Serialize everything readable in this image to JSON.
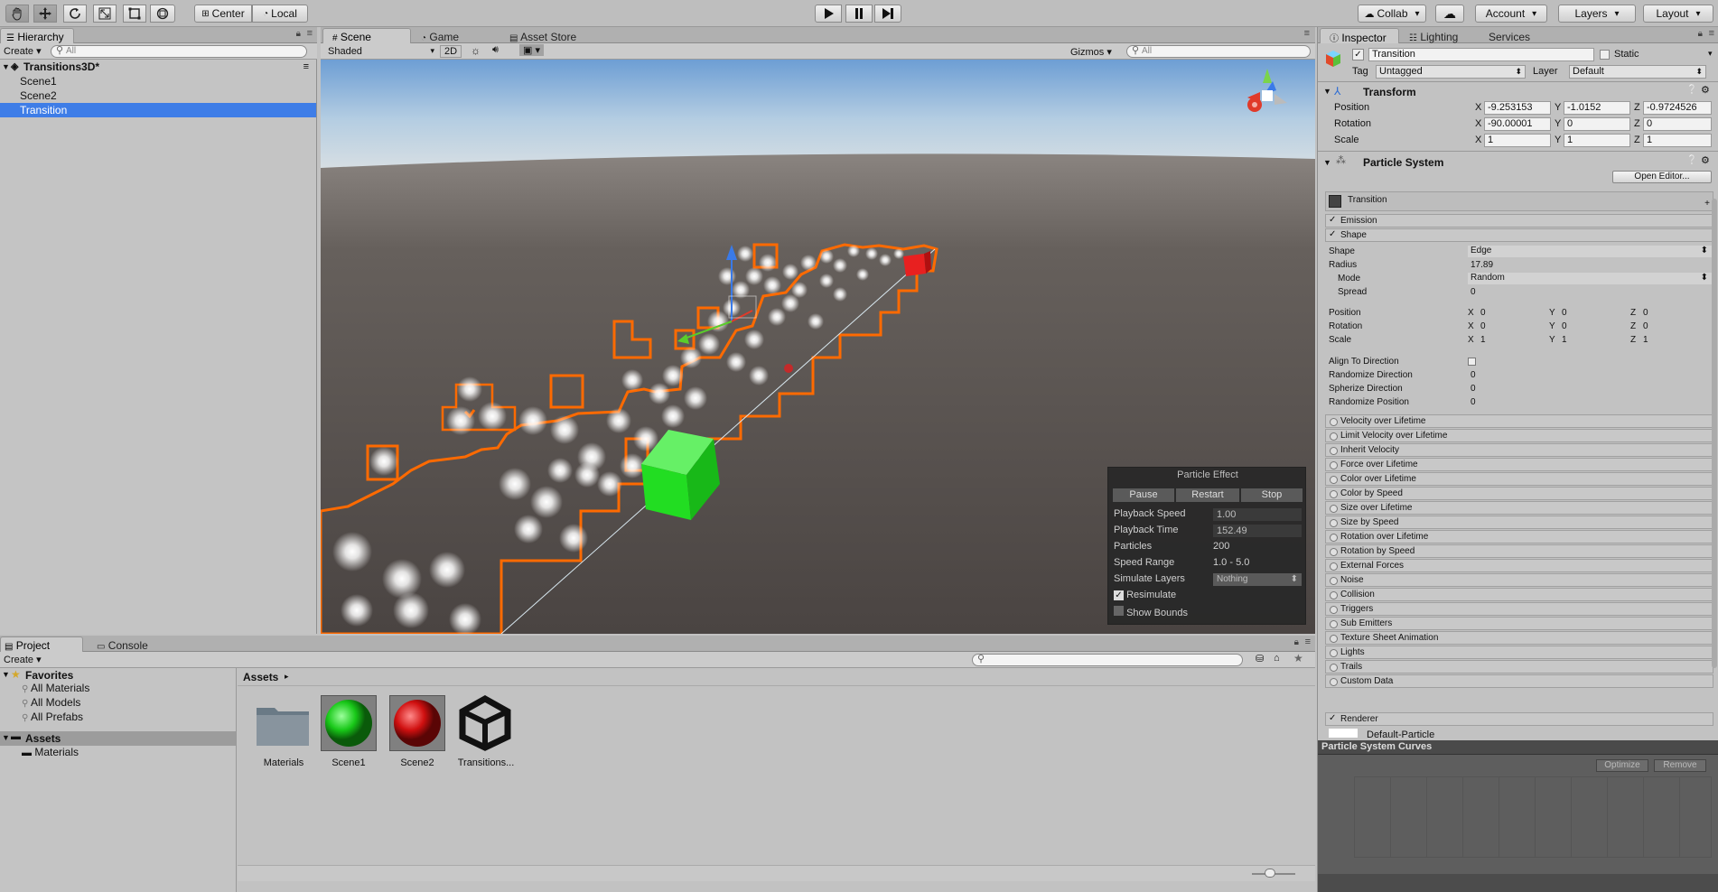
{
  "toolbar": {
    "tools": [
      "hand-tool",
      "move-tool",
      "rotate-tool",
      "scale-tool",
      "rect-tool",
      "transform-tool"
    ],
    "pivot": "Center",
    "space": "Local",
    "collab": "Collab",
    "account": "Account",
    "layers": "Layers",
    "layout": "Layout"
  },
  "hierarchy": {
    "tab": "Hierarchy",
    "create": "Create",
    "search_placeholder": "All",
    "scene_root": "Transitions3D*",
    "items": [
      "Scene1",
      "Scene2",
      "Transition"
    ]
  },
  "scene_view": {
    "tabs": [
      "Scene",
      "Game",
      "Asset Store"
    ],
    "shading": "Shaded",
    "mode_2d": "2D",
    "gizmos": "Gizmos",
    "search_placeholder": "All"
  },
  "particle_effect": {
    "title": "Particle Effect",
    "buttons": [
      "Pause",
      "Restart",
      "Stop"
    ],
    "rows": [
      {
        "label": "Playback Speed",
        "value": "1.00"
      },
      {
        "label": "Playback Time",
        "value": "152.49"
      },
      {
        "label": "Particles",
        "value": "200"
      },
      {
        "label": "Speed Range",
        "value": "1.0 - 5.0"
      },
      {
        "label": "Simulate Layers",
        "value": "Nothing"
      }
    ],
    "resimulate": "Resimulate",
    "show_bounds": "Show Bounds"
  },
  "inspector": {
    "tabs": [
      "Inspector",
      "Lighting",
      "Services"
    ],
    "object_name": "Transition",
    "static": "Static",
    "tag_label": "Tag",
    "tag": "Untagged",
    "layer_label": "Layer",
    "layer": "Default",
    "transform": {
      "title": "Transform",
      "position": {
        "label": "Position",
        "x": "-9.253153",
        "y": "-1.0152",
        "z": "-0.9724526"
      },
      "rotation": {
        "label": "Rotation",
        "x": "-90.00001",
        "y": "0",
        "z": "0"
      },
      "scale": {
        "label": "Scale",
        "x": "1",
        "y": "1",
        "z": "1"
      }
    },
    "particle_system": {
      "title": "Particle System",
      "open_editor": "Open Editor...",
      "name": "Transition",
      "emission": "Emission",
      "shape_module": "Shape",
      "shape": {
        "label": "Shape",
        "value": "Edge"
      },
      "radius": {
        "label": "Radius",
        "value": "17.89"
      },
      "mode": {
        "label": "Mode",
        "value": "Random"
      },
      "spread": {
        "label": "Spread",
        "value": "0"
      },
      "s_position": {
        "label": "Position",
        "x": "0",
        "y": "0",
        "z": "0"
      },
      "s_rotation": {
        "label": "Rotation",
        "x": "0",
        "y": "0",
        "z": "0"
      },
      "s_scale": {
        "label": "Scale",
        "x": "1",
        "y": "1",
        "z": "1"
      },
      "align": "Align To Direction",
      "randomize_dir": {
        "label": "Randomize Direction",
        "value": "0"
      },
      "spherize_dir": {
        "label": "Spherize Direction",
        "value": "0"
      },
      "randomize_pos": {
        "label": "Randomize Position",
        "value": "0"
      },
      "modules": [
        "Velocity over Lifetime",
        "Limit Velocity over Lifetime",
        "Inherit Velocity",
        "Force over Lifetime",
        "Color over Lifetime",
        "Color by Speed",
        "Size over Lifetime",
        "Size by Speed",
        "Rotation over Lifetime",
        "Rotation by Speed",
        "External Forces",
        "Noise",
        "Collision",
        "Triggers",
        "Sub Emitters",
        "Texture Sheet Animation",
        "Lights",
        "Trails",
        "Custom Data"
      ],
      "renderer": "Renderer",
      "default_particle": "Default-Particle"
    },
    "curves": {
      "title": "Particle System Curves",
      "optimize": "Optimize",
      "remove": "Remove"
    }
  },
  "project": {
    "tabs": [
      "Project",
      "Console"
    ],
    "create": "Create",
    "favorites": "Favorites",
    "fav_items": [
      "All Materials",
      "All Models",
      "All Prefabs"
    ],
    "assets_root": "Assets",
    "assets_children": [
      "Materials"
    ],
    "breadcrumb": "Assets",
    "assets": [
      {
        "name": "Materials",
        "icon": "folder-icon"
      },
      {
        "name": "Scene1",
        "icon": "green-sphere-icon"
      },
      {
        "name": "Scene2",
        "icon": "red-sphere-icon"
      },
      {
        "name": "Transitions...",
        "icon": "unity-logo-icon"
      }
    ]
  },
  "colors": {
    "selection": "#3e7de7",
    "outline": "#ff6a00",
    "cube": "#22dd22"
  }
}
